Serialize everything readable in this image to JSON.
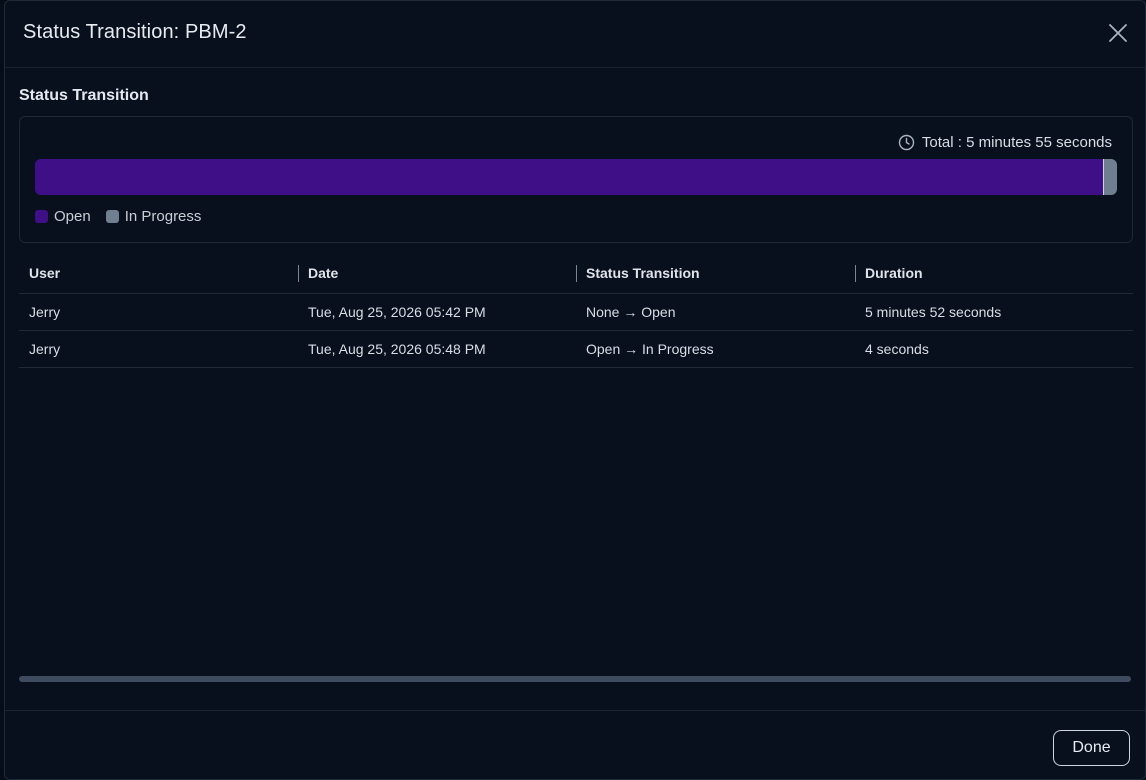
{
  "dialog": {
    "title": "Status Transition: PBM-2",
    "section_title": "Status Transition",
    "close_icon": "close-icon"
  },
  "summary": {
    "total_label": "Total : 5 minutes 55 seconds",
    "icon": "clock-icon"
  },
  "progress": {
    "segments": [
      {
        "name": "Open",
        "fraction": 0.987,
        "color": "#3e0f86"
      },
      {
        "name": "In Progress",
        "fraction": 0.013,
        "color": "#6f7f8f"
      }
    ]
  },
  "legend": {
    "items": [
      {
        "label": "Open",
        "color": "#3e0f86"
      },
      {
        "label": "In Progress",
        "color": "#6f7f8f"
      }
    ]
  },
  "table": {
    "columns": [
      "User",
      "Date",
      "Status Transition",
      "Duration"
    ],
    "rows": [
      {
        "user": "Jerry",
        "date": "Tue, Aug 25, 2026 05:42 PM",
        "transition": "None → Open",
        "duration": "5 minutes 52 seconds"
      },
      {
        "user": "Jerry",
        "date": "Tue, Aug 25, 2026 05:48 PM",
        "transition": "Open → In Progress",
        "duration": "4 seconds"
      }
    ]
  },
  "footer": {
    "done_label": "Done"
  }
}
